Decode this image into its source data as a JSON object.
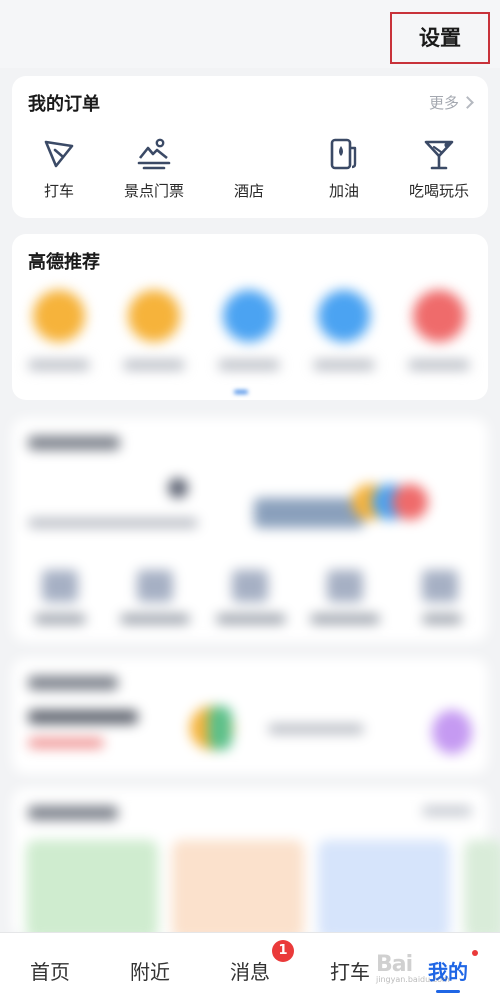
{
  "header": {
    "settings_label": "设置"
  },
  "orders": {
    "title": "我的订单",
    "more_label": "更多",
    "items": [
      {
        "label": "打车",
        "icon": "taxi-arrow-icon"
      },
      {
        "label": "景点门票",
        "icon": "scenic-ticket-icon"
      },
      {
        "label": "酒店",
        "icon": "hotel-icon"
      },
      {
        "label": "加油",
        "icon": "fuel-pump-icon"
      },
      {
        "label": "吃喝玩乐",
        "icon": "cocktail-icon"
      }
    ]
  },
  "recommend": {
    "title": "高德推荐",
    "colors": [
      "#f6b33b",
      "#f6b33b",
      "#4ba3f2",
      "#4ba3f2",
      "#ef6b6b"
    ]
  },
  "tabbar": {
    "items": [
      {
        "label": "首页"
      },
      {
        "label": "附近"
      },
      {
        "label": "消息"
      },
      {
        "label": "打车"
      },
      {
        "label": "我的"
      }
    ],
    "message_badge": "1",
    "active_index": 4
  },
  "watermark": {
    "text": "Bai",
    "sub": "jingyan.baidu.com"
  },
  "colors": {
    "accent": "#1f66e5",
    "badge": "#ea3a3a",
    "highlight_border": "#c8323a"
  }
}
